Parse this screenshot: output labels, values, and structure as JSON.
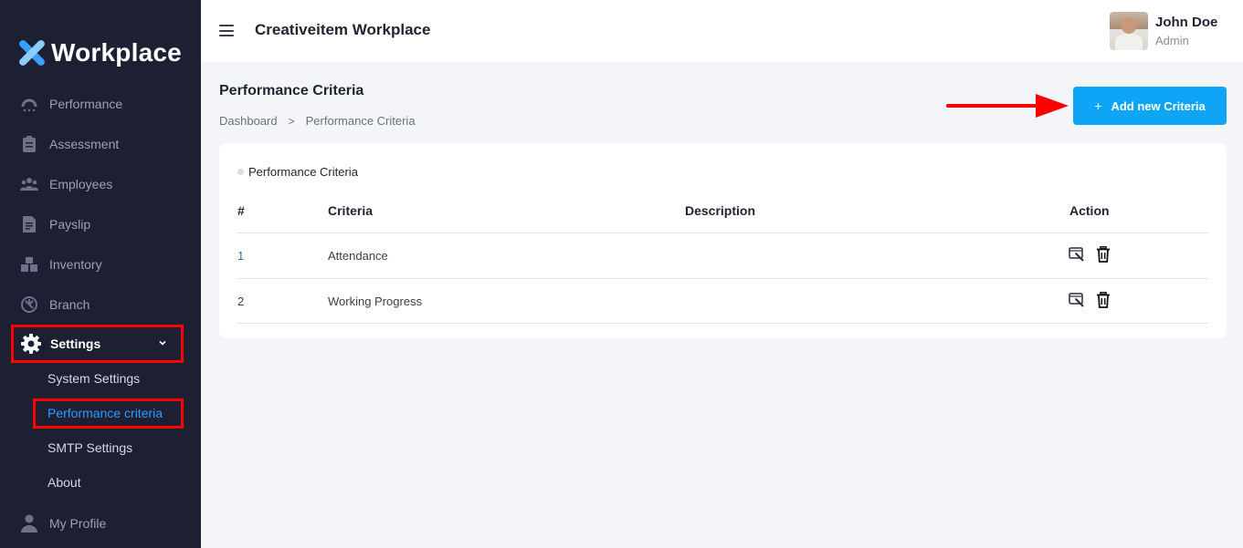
{
  "sidebar": {
    "logo_text": "Workplace",
    "items": [
      {
        "label": "Performance",
        "icon": "gauge-icon"
      },
      {
        "label": "Assessment",
        "icon": "clipboard-icon"
      },
      {
        "label": "Employees",
        "icon": "users-icon"
      },
      {
        "label": "Payslip",
        "icon": "receipt-icon"
      },
      {
        "label": "Inventory",
        "icon": "boxes-icon"
      },
      {
        "label": "Branch",
        "icon": "branch-icon"
      }
    ],
    "settings": {
      "label": "Settings",
      "icon": "gear-icon"
    },
    "sub_items": [
      {
        "label": "System Settings"
      },
      {
        "label": "Performance criteria",
        "active": true
      },
      {
        "label": "SMTP Settings"
      },
      {
        "label": "About"
      }
    ],
    "profile": {
      "label": "My Profile",
      "icon": "user-icon"
    }
  },
  "header": {
    "title": "Creativeitem Workplace",
    "user": {
      "name": "John Doe",
      "role": "Admin"
    }
  },
  "page": {
    "title": "Performance Criteria",
    "breadcrumb": [
      "Dashboard",
      "Performance Criteria"
    ],
    "add_button": {
      "plus": "+",
      "label": "Add new Criteria"
    }
  },
  "table": {
    "card_title": "Performance Criteria",
    "columns": [
      "#",
      "Criteria",
      "Description",
      "Action"
    ],
    "rows": [
      {
        "num": "1",
        "criteria": "Attendance",
        "description": ""
      },
      {
        "num": "2",
        "criteria": "Working Progress",
        "description": ""
      }
    ]
  },
  "colors": {
    "sidebar_bg": "#1d1f33",
    "accent": "#0ea5f7",
    "active_link": "#2f9bff",
    "highlight": "#ff0000"
  }
}
